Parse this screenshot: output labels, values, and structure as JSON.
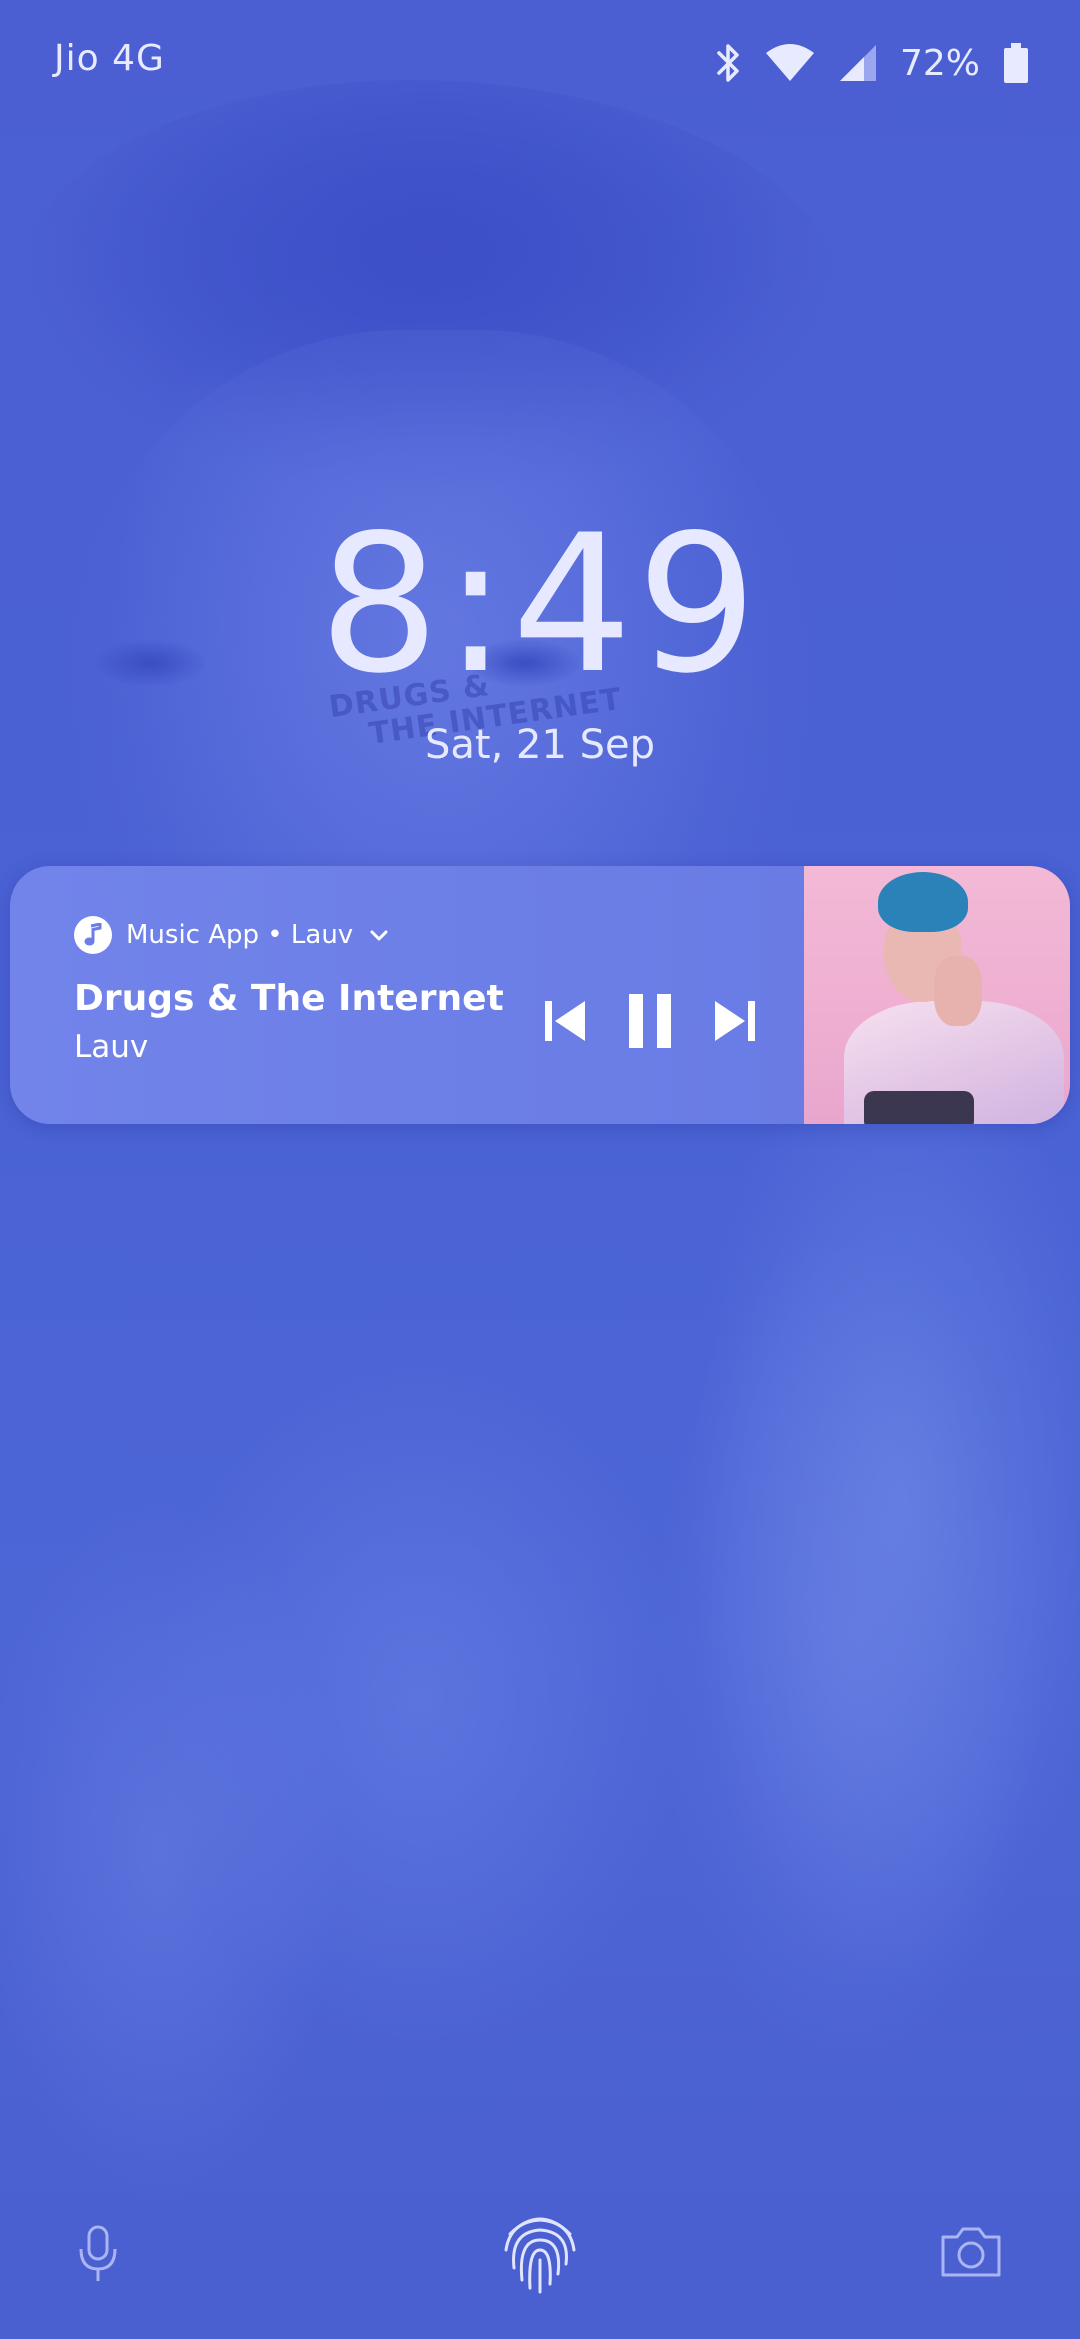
{
  "status_bar": {
    "carrier": "Jio 4G",
    "battery_percent": "72%",
    "icons": [
      "bluetooth-icon",
      "wifi-icon",
      "cell-signal-icon",
      "battery-icon"
    ]
  },
  "lock": {
    "time": "8:49",
    "date": "Sat, 21 Sep"
  },
  "wallpaper": {
    "album_text": [
      "DRUGS &",
      "THE INTERNET"
    ]
  },
  "media": {
    "app_line": "Music App • Lauv",
    "title": "Drugs & The Internet",
    "artist": "Lauv",
    "controls": [
      "previous",
      "pause",
      "next"
    ]
  },
  "shortcuts": {
    "left": "mic-icon",
    "center": "fingerprint-icon",
    "right": "camera-icon"
  },
  "colors": {
    "background": "#4a5ed0",
    "text": "#e6e9ff",
    "card": "#6b7ee6",
    "album_pink": "#efb0d2"
  }
}
